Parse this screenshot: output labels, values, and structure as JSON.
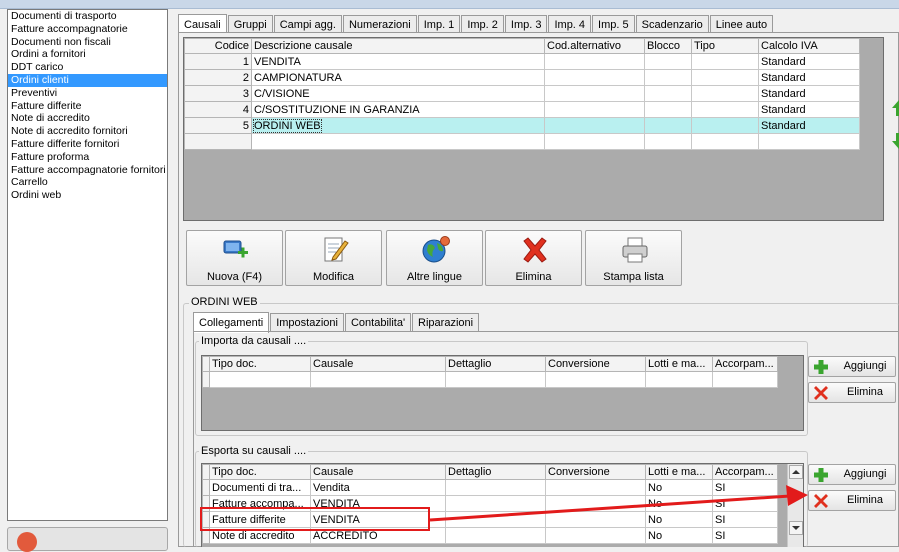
{
  "sidebar": {
    "items": [
      {
        "label": "Documenti di trasporto",
        "selected": false
      },
      {
        "label": "Fatture accompagnatorie",
        "selected": false
      },
      {
        "label": "Documenti non fiscali",
        "selected": false
      },
      {
        "label": "Ordini a fornitori",
        "selected": false
      },
      {
        "label": "DDT carico",
        "selected": false
      },
      {
        "label": "Ordini clienti",
        "selected": true
      },
      {
        "label": "Preventivi",
        "selected": false
      },
      {
        "label": "Fatture differite",
        "selected": false
      },
      {
        "label": "Note di accredito",
        "selected": false
      },
      {
        "label": "Note di accredito fornitori",
        "selected": false
      },
      {
        "label": "Fatture differite fornitori",
        "selected": false
      },
      {
        "label": "Fatture proforma",
        "selected": false
      },
      {
        "label": "Fatture accompagnatorie fornitori",
        "selected": false
      },
      {
        "label": "Carrello",
        "selected": false
      },
      {
        "label": "Ordini web",
        "selected": false
      }
    ]
  },
  "main_tabs": [
    {
      "label": "Causali",
      "active": true
    },
    {
      "label": "Gruppi",
      "active": false
    },
    {
      "label": "Campi agg.",
      "active": false
    },
    {
      "label": "Numerazioni",
      "active": false
    },
    {
      "label": "Imp. 1",
      "active": false
    },
    {
      "label": "Imp. 2",
      "active": false
    },
    {
      "label": "Imp. 3",
      "active": false
    },
    {
      "label": "Imp. 4",
      "active": false
    },
    {
      "label": "Imp. 5",
      "active": false
    },
    {
      "label": "Scadenzario",
      "active": false
    },
    {
      "label": "Linee auto",
      "active": false
    }
  ],
  "causali_grid": {
    "columns": [
      "Codice",
      "Descrizione causale",
      "Cod.alternativo",
      "Blocco",
      "Tipo",
      "Calcolo IVA"
    ],
    "rows": [
      {
        "codice": "1",
        "descrizione": "VENDITA",
        "cod_alt": "",
        "blocco": "",
        "tipo": "",
        "calcolo_iva": "Standard",
        "selected": false
      },
      {
        "codice": "2",
        "descrizione": "CAMPIONATURA",
        "cod_alt": "",
        "blocco": "",
        "tipo": "",
        "calcolo_iva": "Standard",
        "selected": false
      },
      {
        "codice": "3",
        "descrizione": "C/VISIONE",
        "cod_alt": "",
        "blocco": "",
        "tipo": "",
        "calcolo_iva": "Standard",
        "selected": false
      },
      {
        "codice": "4",
        "descrizione": "C/SOSTITUZIONE IN GARANZIA",
        "cod_alt": "",
        "blocco": "",
        "tipo": "",
        "calcolo_iva": "Standard",
        "selected": false
      },
      {
        "codice": "5",
        "descrizione": "ORDINI WEB",
        "cod_alt": "",
        "blocco": "",
        "tipo": "",
        "calcolo_iva": "Standard",
        "selected": true
      }
    ]
  },
  "toolbar": {
    "nuova": "Nuova (F4)",
    "modifica": "Modifica",
    "altre_lingue": "Altre lingue",
    "elimina": "Elimina",
    "stampa_lista": "Stampa lista"
  },
  "detail": {
    "group_title": "ORDINI WEB",
    "tabs": [
      {
        "label": "Collegamenti",
        "active": true
      },
      {
        "label": "Impostazioni",
        "active": false
      },
      {
        "label": "Contabilita'",
        "active": false
      },
      {
        "label": "Riparazioni",
        "active": false
      }
    ],
    "importa": {
      "title": "Importa da causali ....",
      "columns": [
        "Tipo doc.",
        "Causale",
        "Dettaglio",
        "Conversione",
        "Lotti e ma...",
        "Accorpam..."
      ],
      "rows": []
    },
    "esporta": {
      "title": "Esporta su causali ....",
      "columns": [
        "Tipo doc.",
        "Causale",
        "Dettaglio",
        "Conversione",
        "Lotti e ma...",
        "Accorpam..."
      ],
      "rows": [
        {
          "tipo_doc": "Documenti di tra...",
          "causale": "Vendita",
          "dettaglio": "",
          "conversione": "",
          "lotti": "No",
          "accorpam": "SI"
        },
        {
          "tipo_doc": "Fatture accompa...",
          "causale": "VENDITA",
          "dettaglio": "",
          "conversione": "",
          "lotti": "No",
          "accorpam": "SI"
        },
        {
          "tipo_doc": "Fatture differite",
          "causale": "VENDITA",
          "dettaglio": "",
          "conversione": "",
          "lotti": "No",
          "accorpam": "SI"
        },
        {
          "tipo_doc": "Note di accredito",
          "causale": "ACCREDITO",
          "dettaglio": "",
          "conversione": "",
          "lotti": "No",
          "accorpam": "SI"
        }
      ]
    },
    "buttons": {
      "aggiungi": "Aggiungi",
      "elimina": "Elimina"
    }
  },
  "colors": {
    "selection": "#3399ff",
    "row_highlight": "#b9f0f0",
    "annotation": "#e21b1b",
    "add_green": "#3aa52f",
    "delete_red": "#e0301e"
  }
}
